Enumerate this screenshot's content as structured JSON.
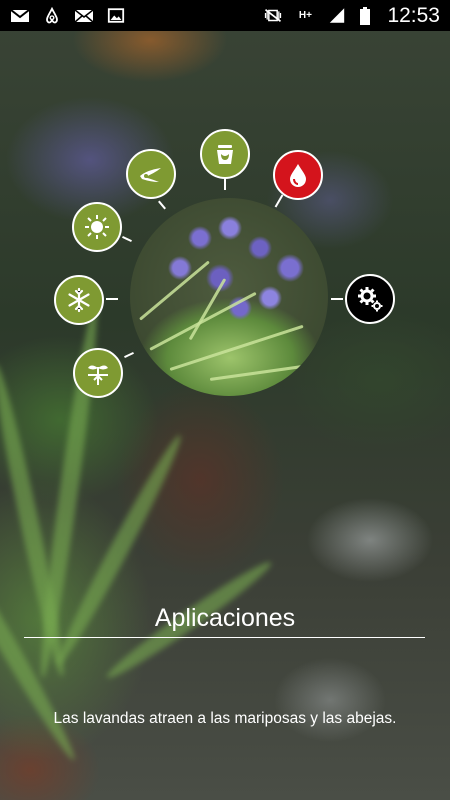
{
  "status_bar": {
    "notifications": [
      "gmail-icon",
      "airbnb-icon",
      "mail-icon",
      "gallery-icon"
    ],
    "network_label": "H+",
    "time": "12:53"
  },
  "plant_menu": {
    "items": [
      {
        "name": "care-watering",
        "icon": "watering-can-icon",
        "active": false
      },
      {
        "name": "water",
        "icon": "water-drop-icon",
        "active": true
      },
      {
        "name": "pruning",
        "icon": "pruning-shears-icon",
        "active": false
      },
      {
        "name": "sun",
        "icon": "sun-icon",
        "active": false
      },
      {
        "name": "frost",
        "icon": "snowflake-icon",
        "active": false
      },
      {
        "name": "planting",
        "icon": "sprout-icon",
        "active": false
      },
      {
        "name": "settings",
        "icon": "gears-icon",
        "active": false
      }
    ],
    "colors": {
      "default": "#7f9a32",
      "active": "#d4141c",
      "settings": "#000000"
    }
  },
  "main": {
    "title": "Aplicaciones",
    "description": "Las lavandas atraen a las mariposas y las abejas."
  }
}
